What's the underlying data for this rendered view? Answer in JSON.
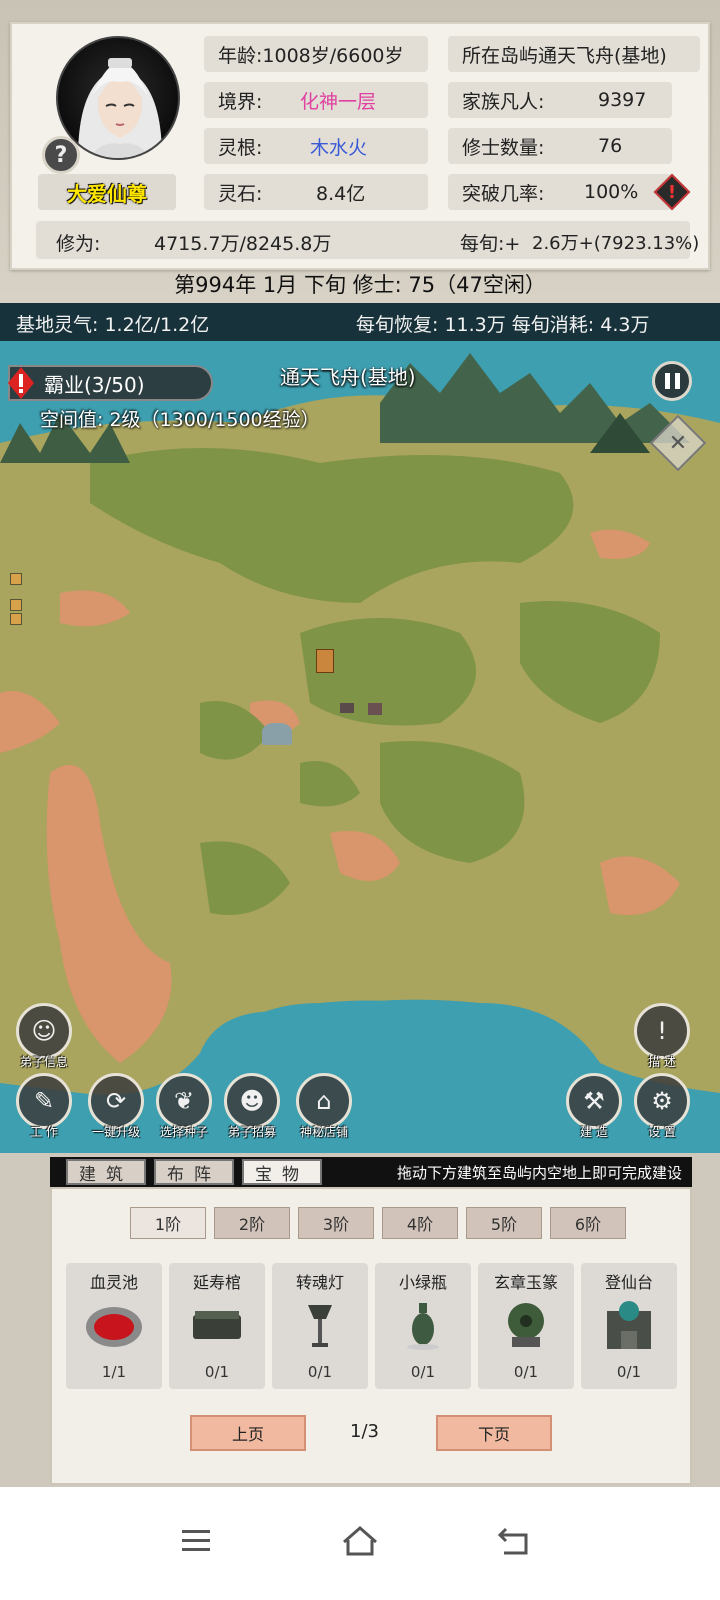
{
  "profile": {
    "name": "大爱仙尊",
    "age_label": "年龄:",
    "age_value": "1008岁/6600岁",
    "realm_label": "境界:",
    "realm_value": "化神一层",
    "root_label": "灵根:",
    "root_value": "木水火",
    "stone_label": "灵石:",
    "stone_value": "8.4亿",
    "island_label": "所在岛屿",
    "island_value": "通天飞舟(基地)",
    "family_label": "家族凡人:",
    "family_value": "9397",
    "cultivators_label": "修士数量:",
    "cultivators_value": "76",
    "breakthrough_label": "突破几率:",
    "breakthrough_value": "100%",
    "xiuwei_label": "修为:",
    "xiuwei_value": "4715.7万/8245.8万",
    "per_tick_label": "每旬:+",
    "per_tick_value": "2.6万+(7923.13%)",
    "help_symbol": "?"
  },
  "date_line": "第994年 1月 下旬   修士: 75（47空闲）",
  "map": {
    "spirit_label": "基地灵气: 1.2亿/1.2亿",
    "recover_label": "每旬恢复: 11.3万 每旬消耗: 4.3万",
    "dominion": "霸业(3/50)",
    "base_title": "通天飞舟(基地)",
    "space_value": "空间值: 2级（1300/1500经验）",
    "actions_left": [
      {
        "label": "弟子信息",
        "icon": "disciple-icon"
      }
    ],
    "actions_bottom": [
      {
        "label": "工 作",
        "icon": "work-icon"
      },
      {
        "label": "一键升级",
        "icon": "upgrade-icon"
      },
      {
        "label": "选择种子",
        "icon": "seed-icon"
      },
      {
        "label": "弟子招募",
        "icon": "recruit-icon"
      },
      {
        "label": "神秘店铺",
        "icon": "shop-icon"
      }
    ],
    "actions_right": [
      {
        "label": "描 述",
        "icon": "exclaim-icon"
      },
      {
        "label": "建 造",
        "icon": "hammer-icon"
      },
      {
        "label": "设 置",
        "icon": "gear-icon"
      }
    ]
  },
  "build": {
    "tabs": [
      "建筑",
      "布阵",
      "宝物"
    ],
    "active_tab": 2,
    "hint": "拖动下方建筑至岛屿内空地上即可完成建设",
    "tiers": [
      "1阶",
      "2阶",
      "3阶",
      "4阶",
      "5阶",
      "6阶"
    ],
    "active_tier": 0,
    "items": [
      {
        "name": "血灵池",
        "count": "1/1",
        "color": "#c8141c"
      },
      {
        "name": "延寿棺",
        "count": "0/1",
        "color": "#3a4038"
      },
      {
        "name": "转魂灯",
        "count": "0/1",
        "color": "#3b3f3a"
      },
      {
        "name": "小绿瓶",
        "count": "0/1",
        "color": "#3e5a40"
      },
      {
        "name": "玄章玉篆",
        "count": "0/1",
        "color": "#3f5c3a"
      },
      {
        "name": "登仙台",
        "count": "0/1",
        "color": "#4a4e48"
      }
    ],
    "prev_label": "上页",
    "next_label": "下页",
    "page": "1/3"
  },
  "colors": {
    "realm": "#e040a0",
    "root": "#3a5ad8",
    "name": "#ffe600",
    "sea": "#3e9fb0",
    "land": "#a9a45e",
    "grass": "#7f9447",
    "sand": "#d9956b"
  }
}
